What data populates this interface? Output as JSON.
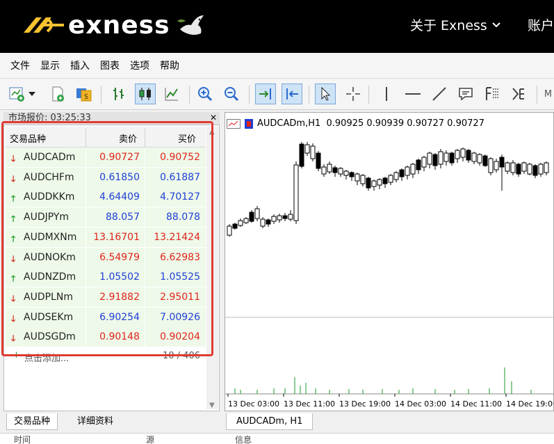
{
  "header": {
    "brand": "exness",
    "nav_about": "关于 Exness",
    "nav_account": "账户"
  },
  "menu": [
    "文件",
    "显示",
    "插入",
    "图表",
    "选项",
    "帮助"
  ],
  "market_watch": {
    "title": "市场报价: 03:25:33",
    "columns": {
      "symbol": "交易品种",
      "bid": "卖价",
      "ask": "买价"
    },
    "rows": [
      {
        "symbol": "AUDCADm",
        "dir": "down",
        "bid": "0.90727",
        "ask": "0.90752",
        "color": "red"
      },
      {
        "symbol": "AUDCHFm",
        "dir": "down",
        "bid": "0.61850",
        "ask": "0.61887",
        "color": "blue"
      },
      {
        "symbol": "AUDDKKm",
        "dir": "up",
        "bid": "4.64409",
        "ask": "4.70127",
        "color": "blue"
      },
      {
        "symbol": "AUDJPYm",
        "dir": "up",
        "bid": "88.057",
        "ask": "88.078",
        "color": "blue"
      },
      {
        "symbol": "AUDMXNm",
        "dir": "up",
        "bid": "13.16701",
        "ask": "13.21424",
        "color": "red"
      },
      {
        "symbol": "AUDNOKm",
        "dir": "down",
        "bid": "6.54979",
        "ask": "6.62983",
        "color": "red"
      },
      {
        "symbol": "AUDNZDm",
        "dir": "up",
        "bid": "1.05502",
        "ask": "1.05525",
        "color": "blue"
      },
      {
        "symbol": "AUDPLNm",
        "dir": "down",
        "bid": "2.91882",
        "ask": "2.95011",
        "color": "red"
      },
      {
        "symbol": "AUDSEKm",
        "dir": "down",
        "bid": "6.90254",
        "ask": "7.00926",
        "color": "blue"
      },
      {
        "symbol": "AUDSGDm",
        "dir": "down",
        "bid": "0.90148",
        "ask": "0.90204",
        "color": "red"
      }
    ],
    "add_label": "点击添加...",
    "count": "10 / 406",
    "tabs": [
      "交易品种",
      "详细资料"
    ]
  },
  "chart": {
    "title": "AUDCADm,H1  0.90925 0.90939 0.90727 0.90727",
    "tab": "AUDCADm, H1",
    "time_labels": [
      "13 Dec 03:00",
      "13 Dec 11:00",
      "13 Dec 19:00",
      "14 Dec 03:00",
      "14 Dec 11:00",
      "14 Dec 19:00"
    ]
  },
  "bottom_labels": [
    "时间",
    "源",
    "信息"
  ],
  "colors": {
    "bid_red": "#e0241b",
    "bid_blue": "#1d3fd6",
    "up": "#1a9a2a",
    "down": "#d3271d",
    "brand_yellow": "#f6c230"
  }
}
